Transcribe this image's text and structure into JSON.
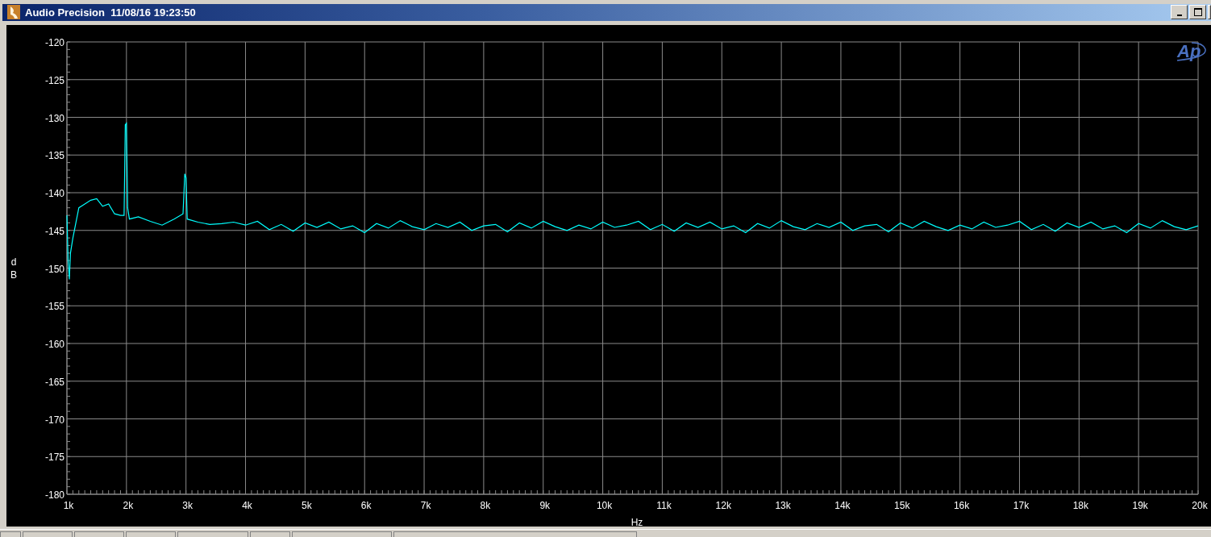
{
  "window": {
    "title": "Audio Precision  11/08/16 19:23:50"
  },
  "graph": {
    "logo_text": "Ap",
    "chart_data": {
      "type": "line",
      "grid": true,
      "xlabel": "Hz",
      "ylabel": "dB",
      "xlim": [
        1000,
        20000
      ],
      "ylim": [
        -180,
        -120
      ],
      "xticks": [
        {
          "value": 1000,
          "label": "1k"
        },
        {
          "value": 2000,
          "label": "2k"
        },
        {
          "value": 3000,
          "label": "3k"
        },
        {
          "value": 4000,
          "label": "4k"
        },
        {
          "value": 5000,
          "label": "5k"
        },
        {
          "value": 6000,
          "label": "6k"
        },
        {
          "value": 7000,
          "label": "7k"
        },
        {
          "value": 8000,
          "label": "8k"
        },
        {
          "value": 9000,
          "label": "9k"
        },
        {
          "value": 10000,
          "label": "10k"
        },
        {
          "value": 11000,
          "label": "11k"
        },
        {
          "value": 12000,
          "label": "12k"
        },
        {
          "value": 13000,
          "label": "13k"
        },
        {
          "value": 14000,
          "label": "14k"
        },
        {
          "value": 15000,
          "label": "15k"
        },
        {
          "value": 16000,
          "label": "16k"
        },
        {
          "value": 17000,
          "label": "17k"
        },
        {
          "value": 18000,
          "label": "18k"
        },
        {
          "value": 19000,
          "label": "19k"
        },
        {
          "value": 20000,
          "label": "20k"
        }
      ],
      "yticks": [
        -120,
        -125,
        -130,
        -135,
        -140,
        -145,
        -150,
        -155,
        -160,
        -165,
        -170,
        -175,
        -180
      ],
      "x": [
        1000,
        1020,
        1040,
        1060,
        1100,
        1150,
        1200,
        1300,
        1400,
        1500,
        1600,
        1700,
        1800,
        1900,
        1960,
        1980,
        2000,
        2020,
        2050,
        2200,
        2400,
        2600,
        2800,
        2950,
        2980,
        3000,
        3020,
        3200,
        3400,
        3600,
        3800,
        4000,
        4200,
        4400,
        4600,
        4800,
        5000,
        5200,
        5400,
        5600,
        5800,
        6000,
        6200,
        6400,
        6600,
        6800,
        7000,
        7200,
        7400,
        7600,
        7800,
        8000,
        8200,
        8400,
        8600,
        8800,
        9000,
        9200,
        9400,
        9600,
        9800,
        10000,
        10200,
        10400,
        10600,
        10800,
        11000,
        11200,
        11400,
        11600,
        11800,
        12000,
        12200,
        12400,
        12600,
        12800,
        13000,
        13200,
        13400,
        13600,
        13800,
        14000,
        14200,
        14400,
        14600,
        14800,
        15000,
        15200,
        15400,
        15600,
        15800,
        16000,
        16200,
        16400,
        16600,
        16800,
        17000,
        17200,
        17400,
        17600,
        17800,
        18000,
        18200,
        18400,
        18600,
        18800,
        19000,
        19200,
        19400,
        19600,
        19800,
        20000
      ],
      "series": [
        {
          "color": "#00ffff",
          "values": [
            -143,
            -149,
            -151.5,
            -148,
            -146,
            -144,
            -142,
            -141.5,
            -141,
            -140.8,
            -141.8,
            -141.5,
            -142.8,
            -143,
            -143,
            -131,
            -130.8,
            -142,
            -143.5,
            -143.2,
            -143.8,
            -144.3,
            -143.5,
            -142.8,
            -137.5,
            -138,
            -143.5,
            -143.9,
            -144.2,
            -144.1,
            -143.9,
            -144.3,
            -143.8,
            -144.9,
            -144.2,
            -145.1,
            -144.0,
            -144.6,
            -143.9,
            -144.8,
            -144.4,
            -145.3,
            -144.1,
            -144.7,
            -143.7,
            -144.5,
            -144.9,
            -144.1,
            -144.6,
            -143.9,
            -145.0,
            -144.4,
            -144.2,
            -145.2,
            -144.0,
            -144.7,
            -143.8,
            -144.5,
            -145.0,
            -144.3,
            -144.8,
            -143.9,
            -144.6,
            -144.3,
            -143.8,
            -144.9,
            -144.2,
            -145.1,
            -144.0,
            -144.6,
            -143.9,
            -144.8,
            -144.4,
            -145.3,
            -144.1,
            -144.7,
            -143.7,
            -144.5,
            -144.9,
            -144.1,
            -144.6,
            -143.9,
            -145.0,
            -144.4,
            -144.2,
            -145.2,
            -144.0,
            -144.7,
            -143.8,
            -144.5,
            -145.0,
            -144.3,
            -144.8,
            -143.9,
            -144.6,
            -144.3,
            -143.8,
            -144.9,
            -144.2,
            -145.1,
            -144.0,
            -144.6,
            -143.9,
            -144.8,
            -144.4,
            -145.3,
            -144.1,
            -144.7,
            -143.7,
            -144.5,
            -144.9,
            -144.4
          ]
        }
      ]
    }
  }
}
